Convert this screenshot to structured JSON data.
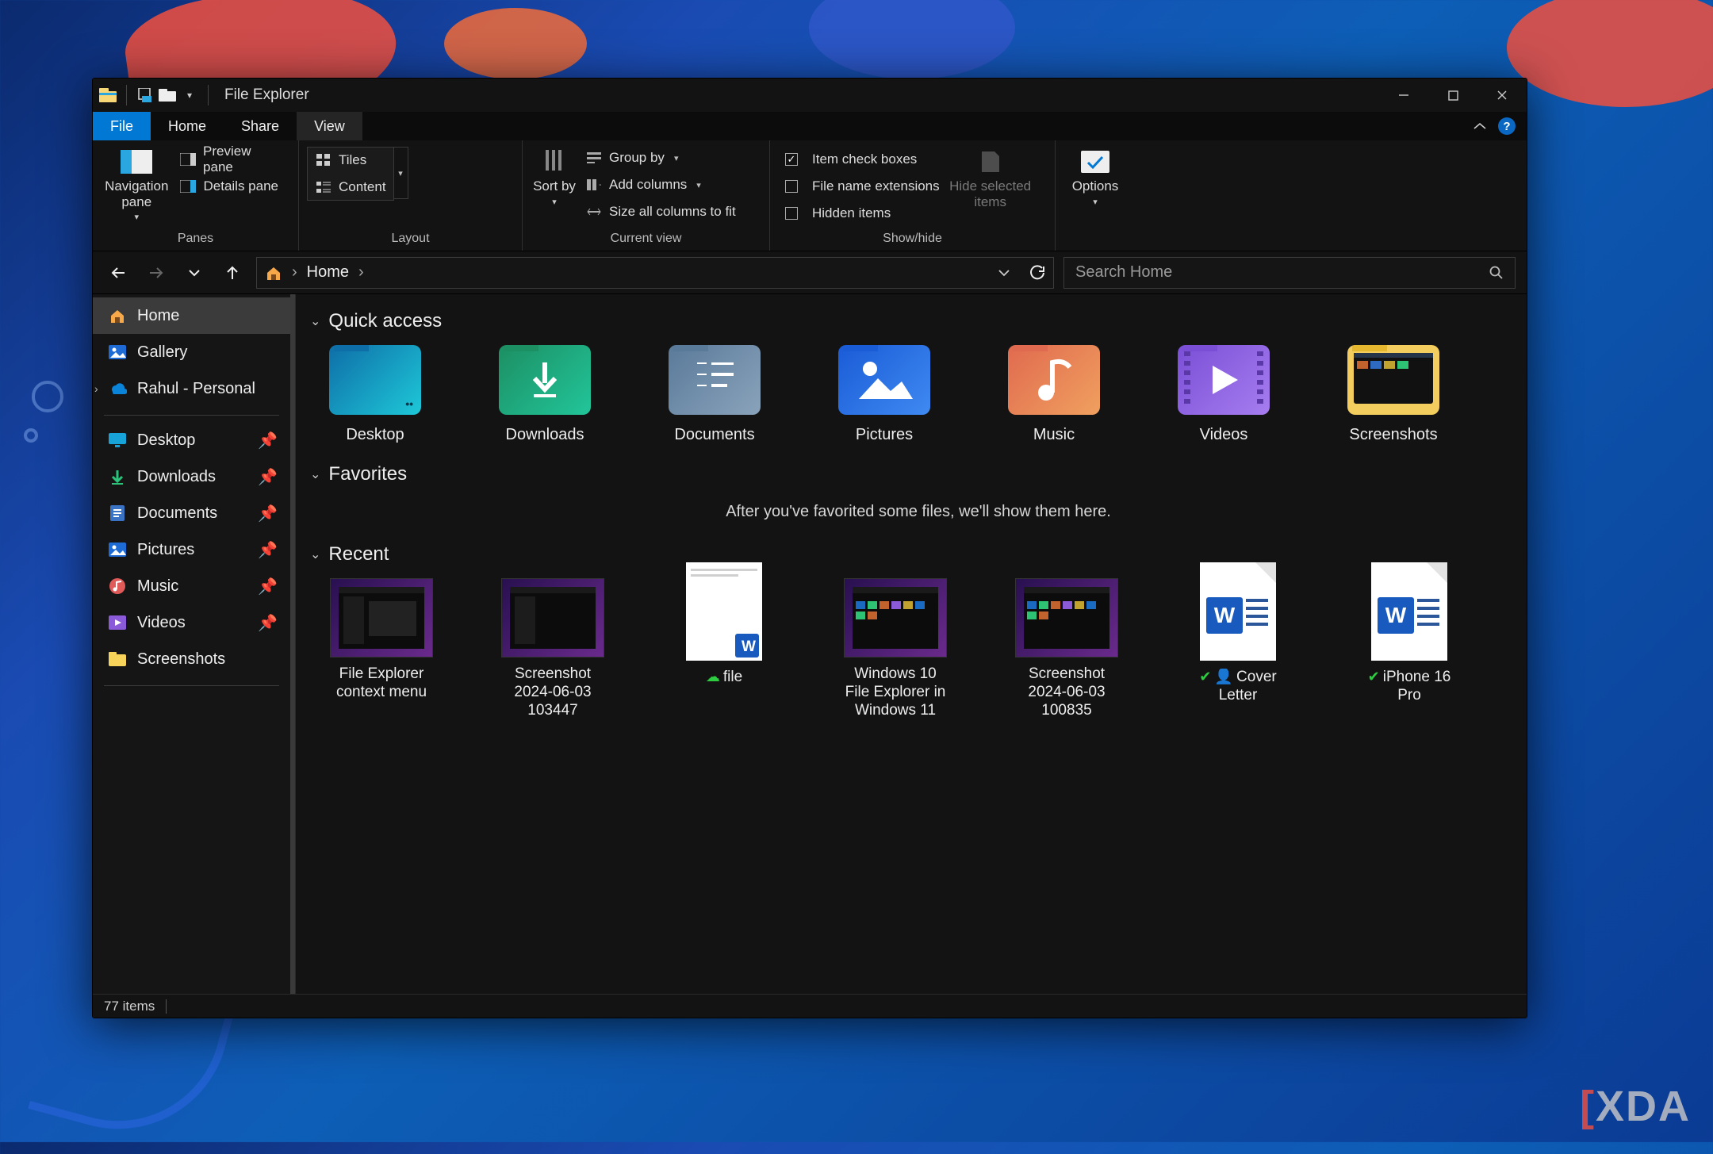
{
  "window": {
    "title": "File Explorer"
  },
  "tabs": {
    "file": "File",
    "home": "Home",
    "share": "Share",
    "view": "View"
  },
  "ribbon": {
    "panes": {
      "label": "Panes",
      "nav": "Navigation pane",
      "preview": "Preview pane",
      "details": "Details pane"
    },
    "layout": {
      "label": "Layout",
      "tiles": "Tiles",
      "content": "Content"
    },
    "current": {
      "label": "Current view",
      "sortby": "Sort by",
      "groupby": "Group by",
      "addcols": "Add columns",
      "sizeall": "Size all columns to fit"
    },
    "showhide": {
      "label": "Show/hide",
      "checkboxes": "Item check boxes",
      "ext": "File name extensions",
      "hidden": "Hidden items",
      "hidesel": "Hide selected items"
    },
    "options": "Options"
  },
  "nav": {
    "location": "Home"
  },
  "search": {
    "placeholder": "Search Home"
  },
  "sidebar": {
    "home": "Home",
    "gallery": "Gallery",
    "onedrive": "Rahul - Personal",
    "desktop": "Desktop",
    "downloads": "Downloads",
    "documents": "Documents",
    "pictures": "Pictures",
    "music": "Music",
    "videos": "Videos",
    "screenshots": "Screenshots"
  },
  "sections": {
    "quick": "Quick access",
    "fav": "Favorites",
    "recent": "Recent"
  },
  "favorites_empty": "After you've favorited some files, we'll show them here.",
  "quick": {
    "desktop": "Desktop",
    "downloads": "Downloads",
    "documents": "Documents",
    "pictures": "Pictures",
    "music": "Music",
    "videos": "Videos",
    "screenshots": "Screenshots"
  },
  "recent": {
    "r1": "File Explorer context menu",
    "r2": "Screenshot 2024-06-03 103447",
    "r3": "file",
    "r4": "Windows 10 File Explorer in Windows 11",
    "r5": "Screenshot 2024-06-03 100835",
    "r6": "Cover Letter",
    "r7": "iPhone 16 Pro"
  },
  "status": {
    "count": "77 items"
  },
  "watermark": "XDA"
}
